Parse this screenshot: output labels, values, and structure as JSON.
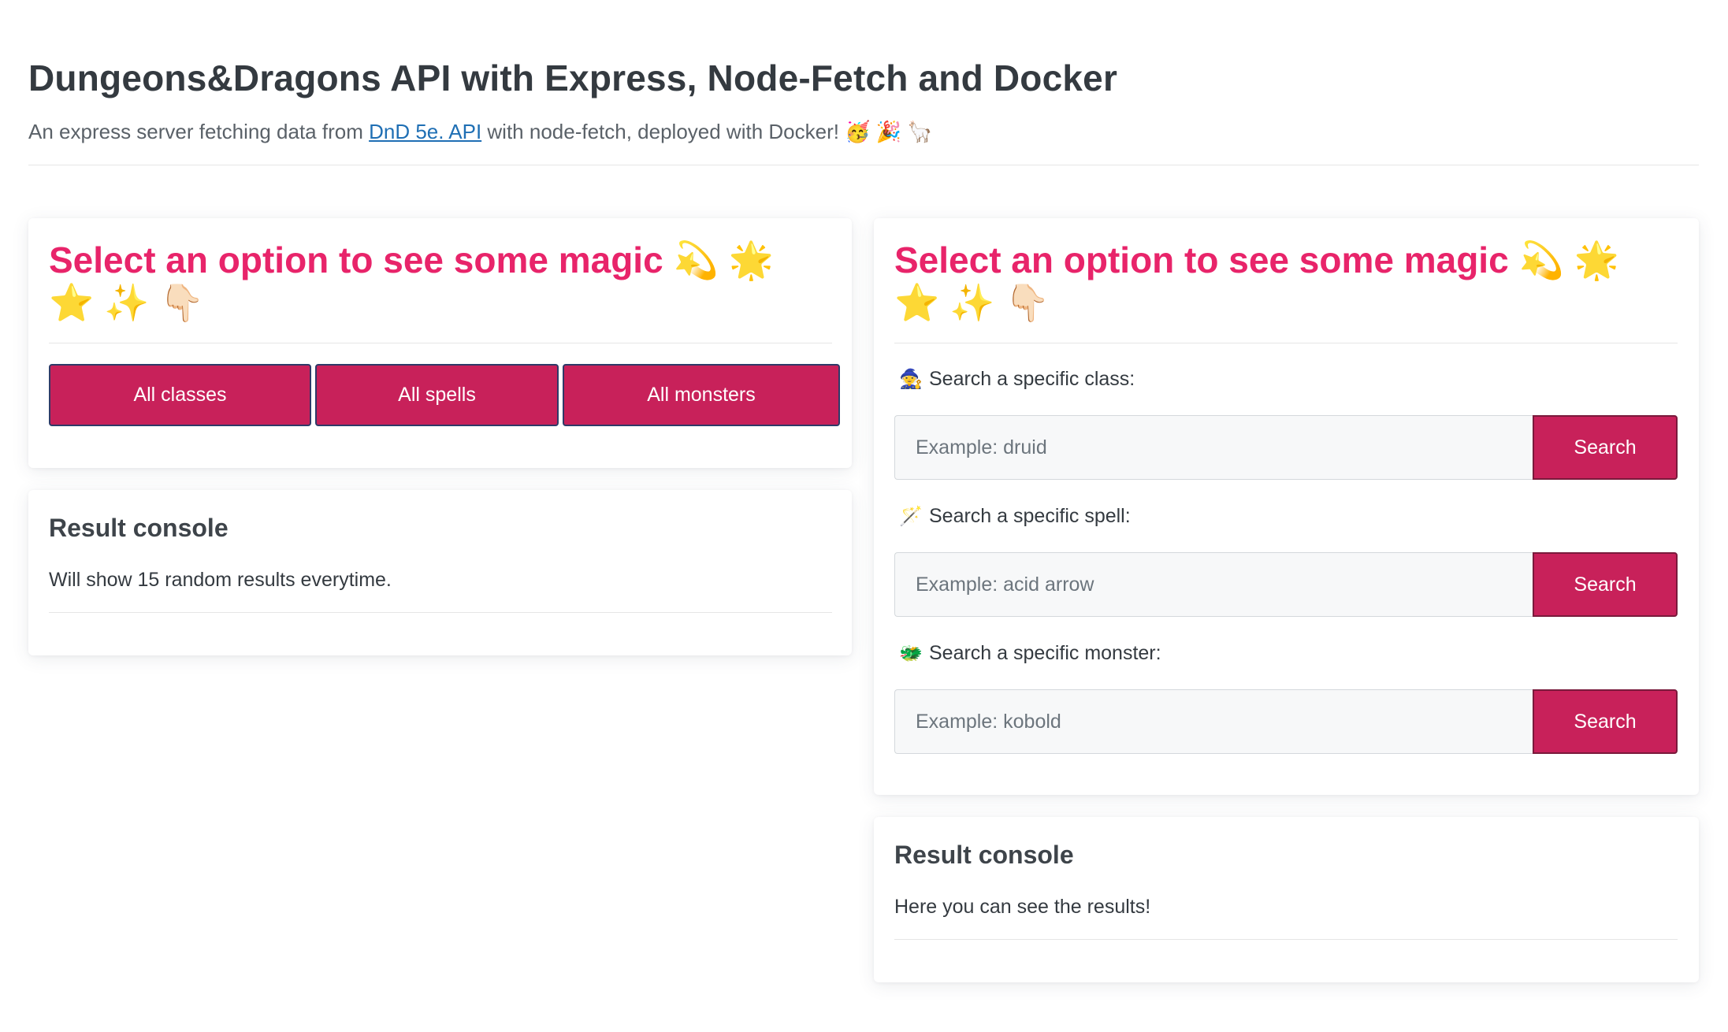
{
  "header": {
    "title": "Dungeons&Dragons API with Express, Node-Fetch and Docker",
    "subtitle_before": "An express server fetching data from ",
    "subtitle_link": "DnD 5e. API",
    "subtitle_after": " with node-fetch, deployed with Docker! 🥳 🎉 🦙"
  },
  "left_panel": {
    "heading": "Select an option to see some magic 💫 🌟 ⭐ ✨ 👇🏻",
    "buttons": {
      "classes": "All classes",
      "spells": "All spells",
      "monsters": "All monsters"
    },
    "result": {
      "title": "Result console",
      "text": "Will show 15 random results everytime."
    }
  },
  "right_panel": {
    "heading": "Select an option to see some magic 💫 🌟 ⭐ ✨ 👇🏻",
    "searches": [
      {
        "icon": "🧙",
        "label": "Search a specific class:",
        "placeholder": "Example: druid",
        "button": "Search"
      },
      {
        "icon": "🪄",
        "label": "Search a specific spell:",
        "placeholder": "Example: acid arrow",
        "button": "Search"
      },
      {
        "icon": "🐲",
        "label": "Search a specific monster:",
        "placeholder": "Example: kobold",
        "button": "Search"
      }
    ],
    "result": {
      "title": "Result console",
      "text": "Here you can see the results!"
    }
  },
  "colors": {
    "accent": "#c8215a",
    "heading_pink": "#e8246a",
    "link": "#1f6fb4"
  }
}
